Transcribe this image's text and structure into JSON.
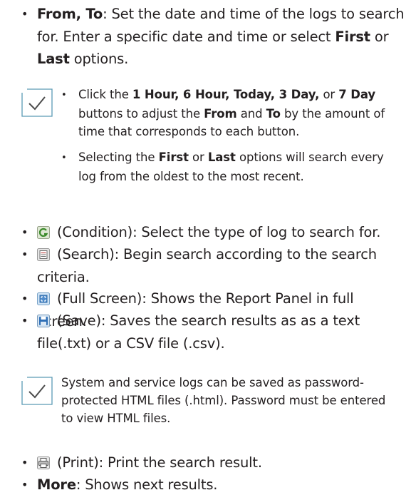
{
  "items": [
    {
      "label": "From, To",
      "text": ": Set the date and time of the logs to search for. Enter a specific date and time or select ",
      "first": "First",
      "or": " or ",
      "last": "Last",
      "after": " options."
    }
  ],
  "note1": {
    "icon": "checkmark-icon",
    "bullet1_pre": "Click the ",
    "bullet1_buttons": "1 Hour, 6 Hour, Today, 3 Day,",
    "bullet1_or": " or ",
    "bullet1_7day": "7 Day",
    "bullet1_mid": " buttons to adjust the ",
    "bullet1_from": "From",
    "bullet1_and": " and ",
    "bullet1_to": "To",
    "bullet1_post": " by the amount of time that corresponds to each button.",
    "bullet2_pre": "Selecting the ",
    "bullet2_first": "First",
    "bullet2_or": " or ",
    "bullet2_last": "Last",
    "bullet2_post": " options will search every log from the oldest to the most recent."
  },
  "condition": {
    "icon": "condition-icon",
    "text": " (Condition): Select the type of log to search for."
  },
  "search": {
    "icon": "search-icon",
    "text": " (Search): Begin search according to the search criteria."
  },
  "fullscreen": {
    "icon": "full-screen-icon",
    "text": " (Full Screen): Shows the Report Panel in full screen."
  },
  "save": {
    "icon": "save-icon",
    "text": " (Save): Saves the search results as as a text file(.txt) or a CSV file (.csv)."
  },
  "note2": {
    "icon": "checkmark-icon",
    "text": "System and service logs can be saved as password-protected HTML files (.html). Password must be entered to view HTML files."
  },
  "print": {
    "icon": "print-icon",
    "text": " (Print): Print the search result."
  },
  "more": {
    "label": "More",
    "text": ": Shows next results."
  },
  "colors": {
    "text": "#231f20",
    "note_icon_border": "#5a9ab5",
    "check": "#4d4d4d"
  }
}
